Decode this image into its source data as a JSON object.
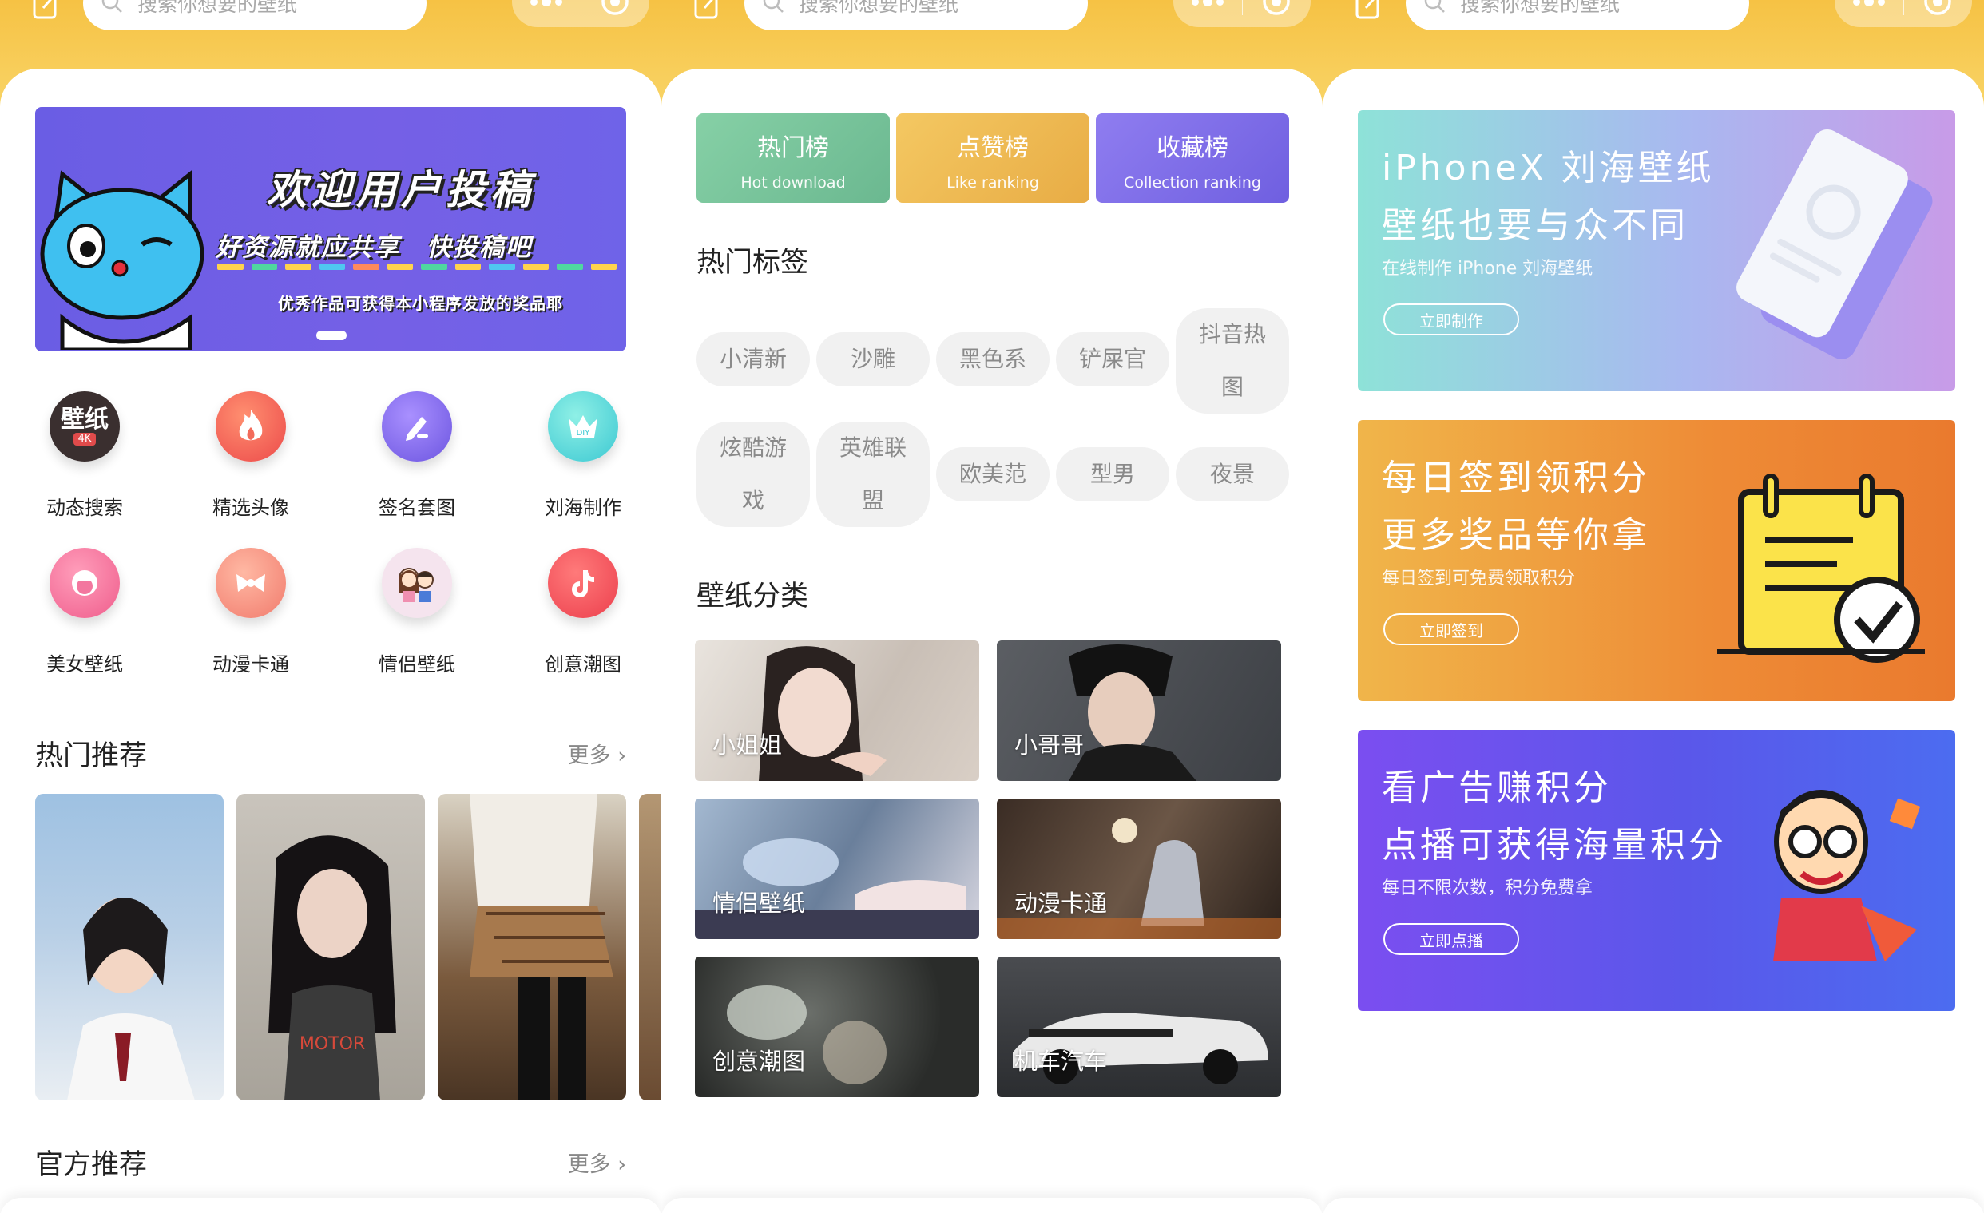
{
  "search": {
    "placeholder": "搜索你想要的壁纸"
  },
  "home": {
    "banner": {
      "line1": "欢迎用户投稿",
      "line2": "好资源就应共享　快投稿吧",
      "line3": "优秀作品可获得本小程序发放的奖品耶"
    },
    "grid": [
      {
        "label": "动态搜索",
        "icon": "wallpaper-4k-icon",
        "badge": "壁纸",
        "sub": "4K"
      },
      {
        "label": "精选头像",
        "icon": "fire-icon"
      },
      {
        "label": "签名套图",
        "icon": "pen-icon"
      },
      {
        "label": "刘海制作",
        "icon": "diy-crown-icon",
        "badge": "DIY"
      },
      {
        "label": "美女壁纸",
        "icon": "girl-icon"
      },
      {
        "label": "动漫卡通",
        "icon": "bow-icon"
      },
      {
        "label": "情侣壁纸",
        "icon": "couple-icon"
      },
      {
        "label": "创意潮图",
        "icon": "tiktok-icon"
      }
    ],
    "hot_title": "热门推荐",
    "more": "更多",
    "official_title": "官方推荐"
  },
  "discover": {
    "ranks": [
      {
        "title": "热门榜",
        "sub": "Hot download",
        "color": "#78c59a"
      },
      {
        "title": "点赞榜",
        "sub": "Like ranking",
        "color": "#efbb52"
      },
      {
        "title": "收藏榜",
        "sub": "Collection ranking",
        "color": "#7f6ee6"
      }
    ],
    "tags_title": "热门标签",
    "tags": [
      "小清新",
      "沙雕",
      "黑色系",
      "铲屎官",
      "抖音热图",
      "炫酷游戏",
      "英雄联盟",
      "欧美范",
      "型男",
      "夜景"
    ],
    "cat_title": "壁纸分类",
    "categories": [
      "小姐姐",
      "小哥哥",
      "情侣壁纸",
      "动漫卡通",
      "创意潮图",
      "机车汽车"
    ]
  },
  "tasks": {
    "promos": [
      {
        "h1": "iPhoneX 刘海壁纸",
        "h2": "壁纸也要与众不同",
        "h3": "在线制作 iPhone 刘海壁纸",
        "btn": "立即制作"
      },
      {
        "h1": "每日签到领积分",
        "h2": "更多奖品等你拿",
        "h3": "每日签到可免费领取积分",
        "btn": "立即签到"
      },
      {
        "h1": "看广告赚积分",
        "h2": "点播可获得海量积分",
        "h3": "每日不限次数，积分免费拿",
        "btn": "立即点播"
      }
    ]
  },
  "colors": {
    "accent": "#f6c244",
    "tag_bg": "#f1f1f1"
  }
}
